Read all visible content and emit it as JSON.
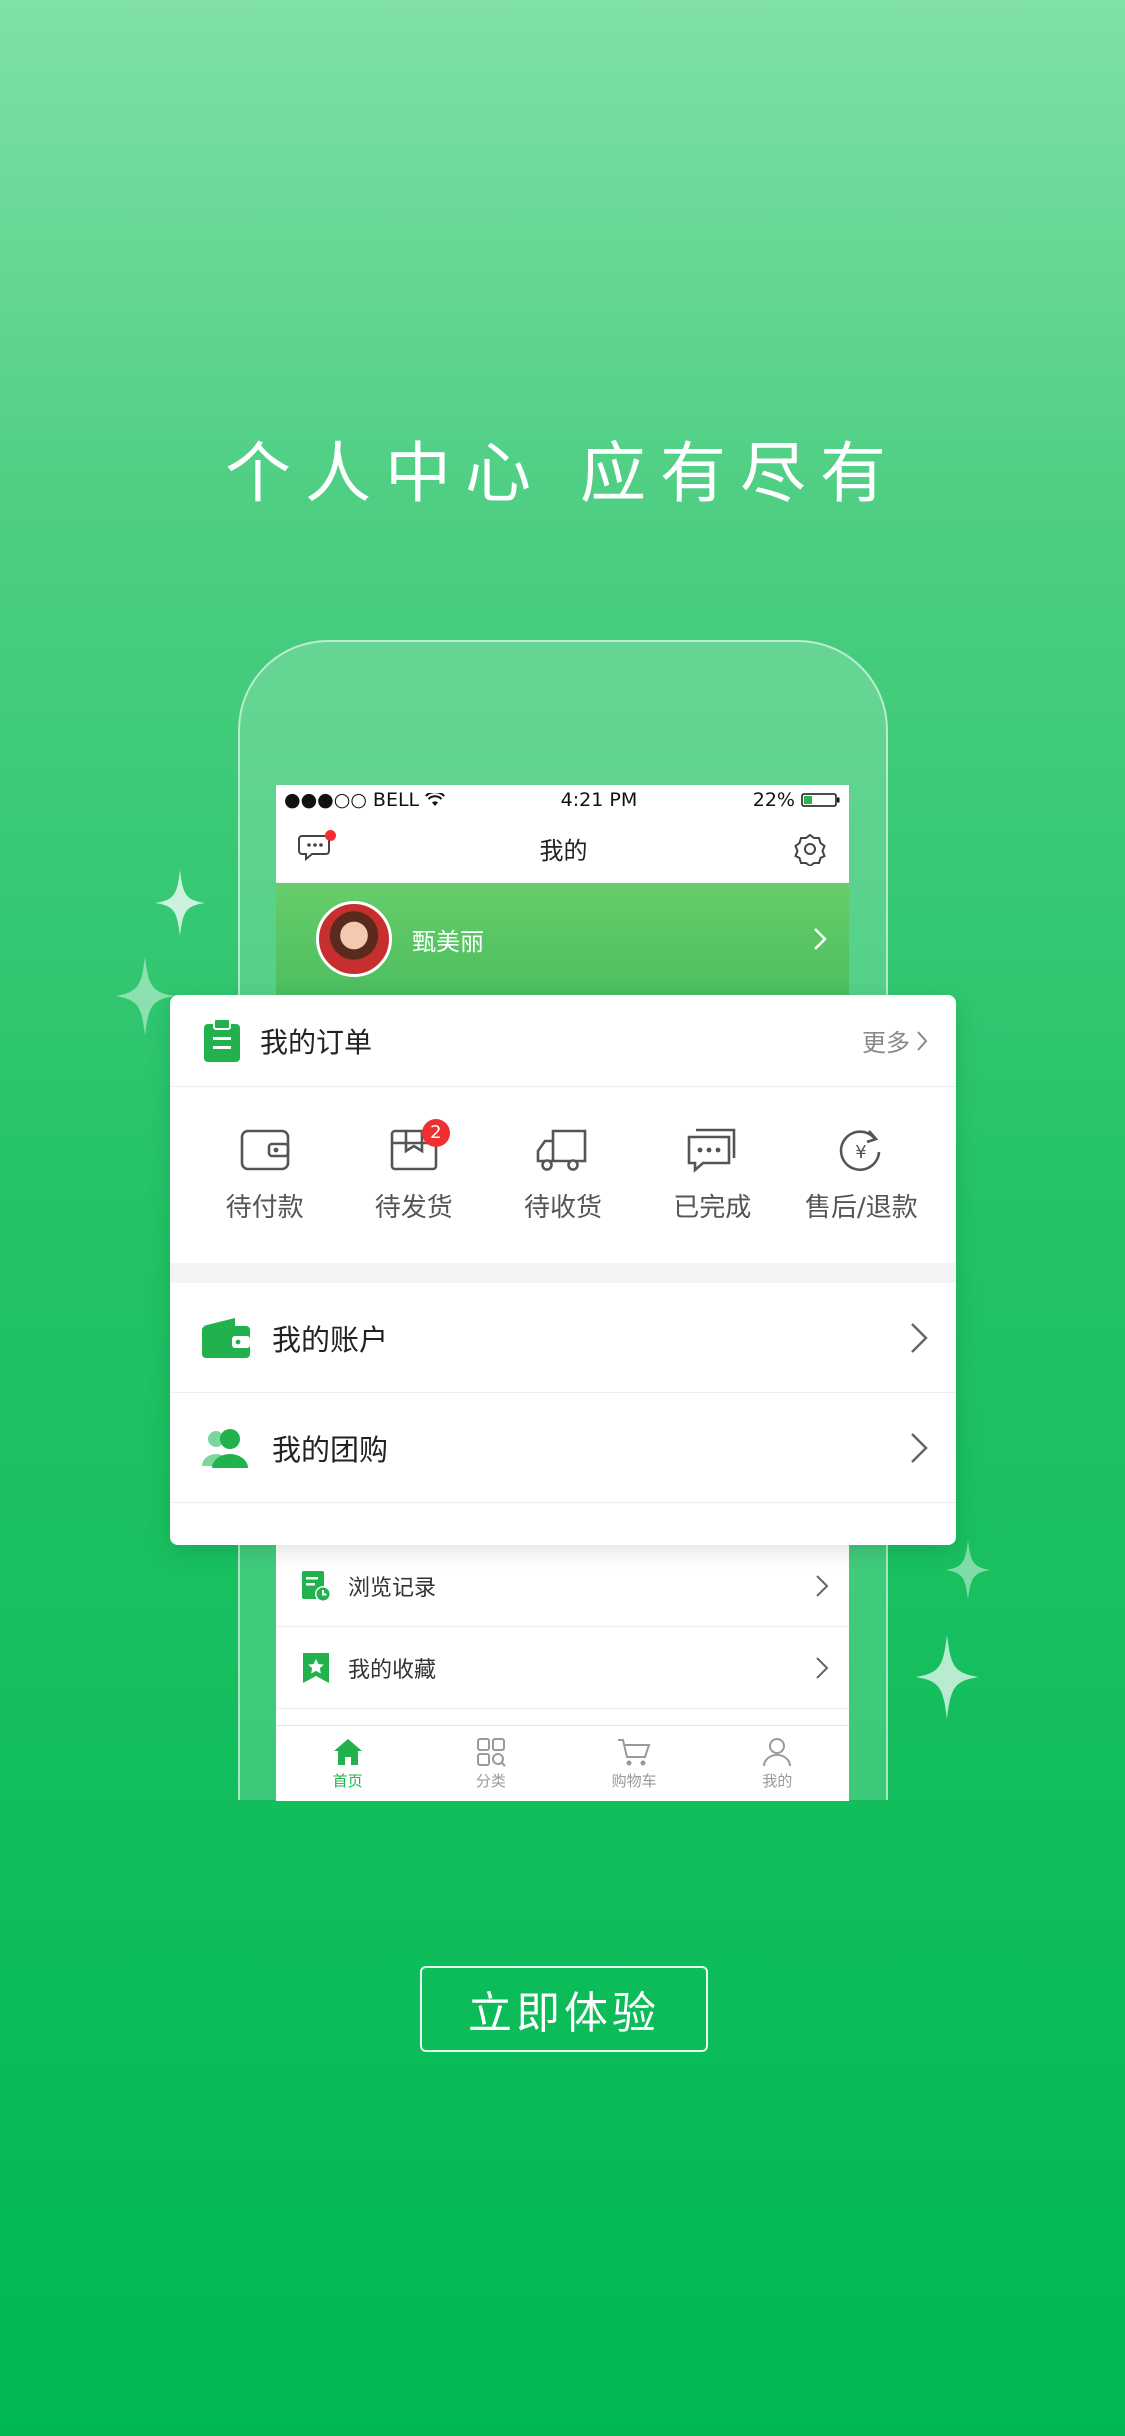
{
  "headline": "个人中心   应有尽有",
  "colors": {
    "brand_green": "#21b14d",
    "badge_red": "#f03030"
  },
  "phone": {
    "status_bar": {
      "carrier": "●●●○○ BELL",
      "time": "4:21 PM",
      "battery": "22%"
    },
    "nav": {
      "title": "我的",
      "left_icon": "message-icon",
      "right_icon": "settings-icon"
    },
    "profile": {
      "name": "甄美丽"
    },
    "list": [
      {
        "label": "浏览记录",
        "icon": "history-icon"
      },
      {
        "label": "我的收藏",
        "icon": "favorite-icon"
      }
    ],
    "tabs": [
      {
        "label": "首页",
        "icon": "home-icon",
        "active": true
      },
      {
        "label": "分类",
        "icon": "category-icon",
        "active": false
      },
      {
        "label": "购物车",
        "icon": "cart-icon",
        "active": false
      },
      {
        "label": "我的",
        "icon": "user-icon",
        "active": false
      }
    ]
  },
  "orders_card": {
    "title": "我的订单",
    "more": "更多",
    "items": [
      {
        "label": "待付款",
        "icon": "wallet-icon"
      },
      {
        "label": "待发货",
        "icon": "package-icon",
        "badge": "2"
      },
      {
        "label": "待收货",
        "icon": "truck-icon"
      },
      {
        "label": "已完成",
        "icon": "chat-done-icon"
      },
      {
        "label": "售后/退款",
        "icon": "refund-icon"
      }
    ],
    "rows": [
      {
        "label": "我的账户",
        "icon": "account-wallet-icon"
      },
      {
        "label": "我的团购",
        "icon": "group-buy-icon"
      }
    ]
  },
  "cta": {
    "label": "立即体验"
  }
}
